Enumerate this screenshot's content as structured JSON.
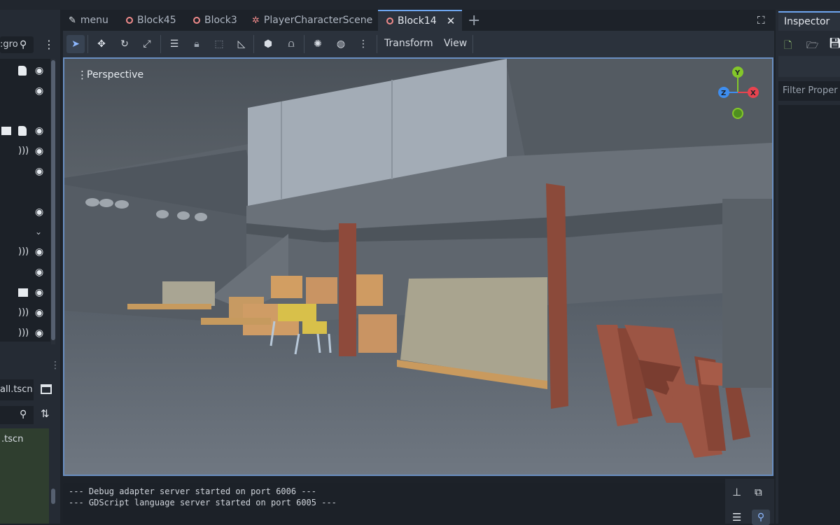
{
  "tabs": [
    {
      "label": "menu",
      "icon": "script-icon"
    },
    {
      "label": "Block45",
      "icon": "node3d-icon"
    },
    {
      "label": "Block3",
      "icon": "node3d-icon"
    },
    {
      "label": "PlayerCharacterScene",
      "icon": "skeleton-icon"
    },
    {
      "label": "Block14",
      "icon": "node3d-icon",
      "active": true
    }
  ],
  "tab_close": "✕",
  "tab_add": "+",
  "scene_dock": {
    "search_fragment": ":gro"
  },
  "toolbar": {
    "transform_label": "Transform",
    "view_label": "View"
  },
  "viewport": {
    "perspective_label": "Perspective",
    "gizmo": {
      "y": "Y",
      "z": "Z",
      "x": "X"
    }
  },
  "filesystem": {
    "tab_fragment": "all.tscn",
    "item_fragment": ".tscn"
  },
  "output": {
    "lines": [
      "--- Debug adapter server started on port 6006 ---",
      "--- GDScript language server started on port 6005 ---"
    ]
  },
  "inspector": {
    "tab_label": "Inspector",
    "filter_placeholder": "Filter Proper"
  },
  "colors": {
    "accent": "#6ea6f0",
    "tab_ring": "#ef8a8a",
    "gizmo_x": "#e8434f",
    "gizmo_y": "#84c72a",
    "gizmo_z": "#3e8ef0"
  }
}
